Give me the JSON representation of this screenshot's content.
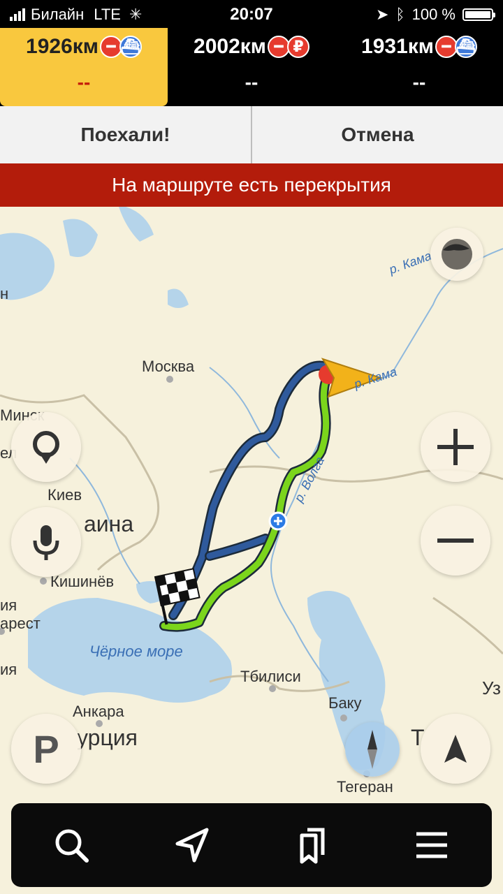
{
  "status": {
    "carrier": "Билайн",
    "network": "LTE",
    "time": "20:07",
    "battery": "100 %"
  },
  "routes": [
    {
      "distance": "1926км",
      "eta": "--",
      "badges": [
        "no-entry-icon",
        "ferry-icon"
      ],
      "active": true
    },
    {
      "distance": "2002км",
      "eta": "--",
      "badges": [
        "no-entry-icon",
        "toll-icon"
      ],
      "active": false
    },
    {
      "distance": "1931км",
      "eta": "--",
      "badges": [
        "no-entry-icon",
        "ferry-icon"
      ],
      "active": false
    }
  ],
  "badge_glyphs": {
    "toll": "₽"
  },
  "actions": {
    "go": "Поехали!",
    "cancel": "Отмена"
  },
  "alert": "На маршруте есть перекрытия",
  "map": {
    "labels": {
      "moscow": "Москва",
      "minsk": "Минск",
      "kiev": "Киев",
      "ukraina": "аина",
      "chisinau": "Кишинёв",
      "black_sea": "Чёрное море",
      "tbilisi": "Тбилиси",
      "baku": "Баку",
      "ankara": "Анкара",
      "turkey": "урция",
      "tehran": "Тегеран",
      "volga": "р. Волга",
      "kama1": "р. Кама",
      "kama2": "р. Кама",
      "uz": "Уз",
      "edge_n": "н",
      "edge_el": "ел",
      "edge_ia": "ия",
      "edge_arest": "арест",
      "edge_ia2": "ия",
      "edge_t": "Т"
    }
  },
  "toolbar": [
    "search-icon",
    "navigation-arrow-icon",
    "bookmarks-icon",
    "menu-icon"
  ],
  "colors": {
    "active_route_tab": "#f9c83e",
    "alert_bg": "#b31c0b",
    "route_green": "#7bd51c",
    "route_blue": "#2f5a9c"
  }
}
